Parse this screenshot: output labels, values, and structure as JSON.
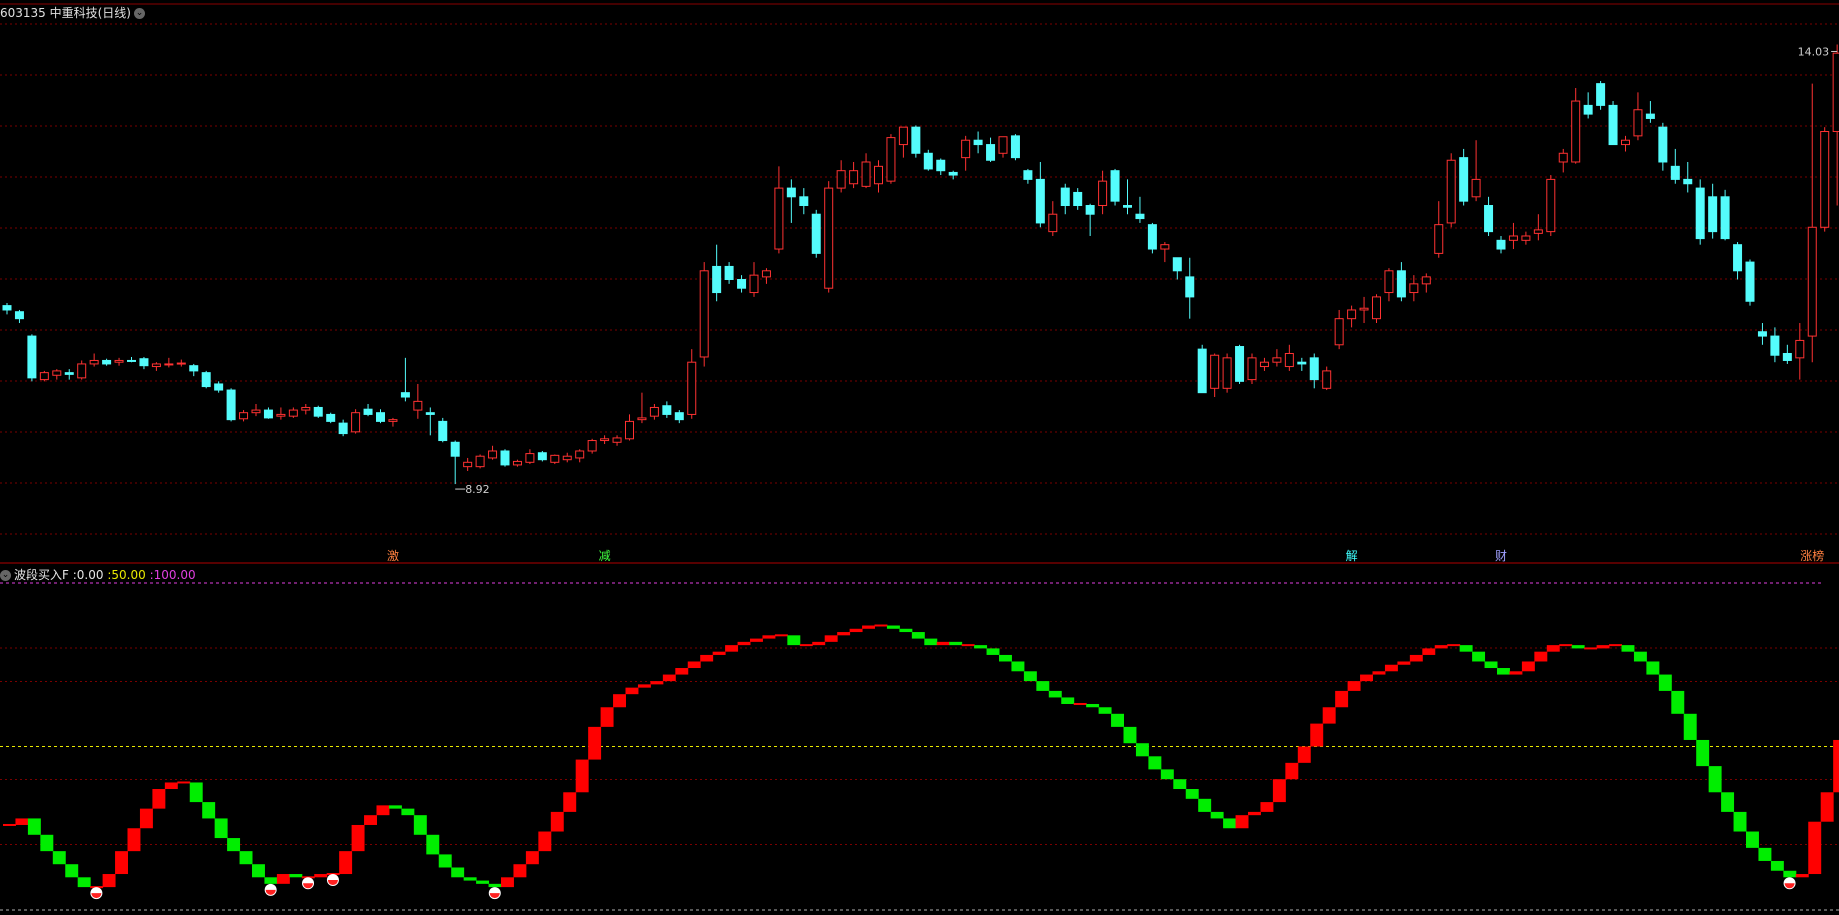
{
  "header": {
    "title": "603135 中重科技(日线)",
    "indicator_name": "波段买入F",
    "values": [
      ":0.00",
      ":50.00",
      ":100.00"
    ]
  },
  "colors": {
    "up": "#ff3232",
    "down": "#54fcfc",
    "buy_bar": "#ff0000",
    "sell_bar": "#00ee00",
    "grid": "#7a0000",
    "yellow": "#e8e800",
    "magenta": "#e040e0"
  },
  "chart_data": [
    {
      "type": "candlestick",
      "ylim": [
        8.3,
        14.4
      ],
      "annotations": {
        "high": "14.03",
        "low": "8.92"
      },
      "event_labels": [
        {
          "text": "激",
          "index": 31,
          "color": "#ff8040"
        },
        {
          "text": "减",
          "index": 48,
          "color": "#40ff40"
        },
        {
          "text": "解",
          "index": 108,
          "color": "#40ffff"
        },
        {
          "text": "财",
          "index": 120,
          "color": "#a0a0ff"
        },
        {
          "text": "涨榜",
          "index": 145,
          "color": "#ff8040"
        }
      ],
      "candles": [
        {
          "o": 11.05,
          "h": 11.08,
          "l": 10.95,
          "c": 11.0
        },
        {
          "o": 10.98,
          "h": 11.0,
          "l": 10.85,
          "c": 10.9
        },
        {
          "o": 10.7,
          "h": 10.72,
          "l": 10.18,
          "c": 10.22
        },
        {
          "o": 10.2,
          "h": 10.3,
          "l": 10.18,
          "c": 10.28
        },
        {
          "o": 10.25,
          "h": 10.32,
          "l": 10.2,
          "c": 10.3
        },
        {
          "o": 10.28,
          "h": 10.32,
          "l": 10.2,
          "c": 10.26
        },
        {
          "o": 10.22,
          "h": 10.42,
          "l": 10.2,
          "c": 10.38
        },
        {
          "o": 10.38,
          "h": 10.5,
          "l": 10.35,
          "c": 10.42
        },
        {
          "o": 10.42,
          "h": 10.44,
          "l": 10.36,
          "c": 10.38
        },
        {
          "o": 10.4,
          "h": 10.45,
          "l": 10.36,
          "c": 10.42
        },
        {
          "o": 10.42,
          "h": 10.46,
          "l": 10.4,
          "c": 10.41
        },
        {
          "o": 10.44,
          "h": 10.46,
          "l": 10.32,
          "c": 10.36
        },
        {
          "o": 10.35,
          "h": 10.4,
          "l": 10.3,
          "c": 10.38
        },
        {
          "o": 10.38,
          "h": 10.45,
          "l": 10.34,
          "c": 10.38
        },
        {
          "o": 10.39,
          "h": 10.43,
          "l": 10.35,
          "c": 10.39
        },
        {
          "o": 10.36,
          "h": 10.38,
          "l": 10.24,
          "c": 10.3
        },
        {
          "o": 10.28,
          "h": 10.3,
          "l": 10.1,
          "c": 10.12
        },
        {
          "o": 10.15,
          "h": 10.18,
          "l": 10.05,
          "c": 10.08
        },
        {
          "o": 10.08,
          "h": 10.1,
          "l": 9.72,
          "c": 9.74
        },
        {
          "o": 9.75,
          "h": 9.85,
          "l": 9.72,
          "c": 9.82
        },
        {
          "o": 9.82,
          "h": 9.92,
          "l": 9.78,
          "c": 9.85
        },
        {
          "o": 9.85,
          "h": 9.88,
          "l": 9.75,
          "c": 9.76
        },
        {
          "o": 9.78,
          "h": 9.88,
          "l": 9.74,
          "c": 9.8
        },
        {
          "o": 9.78,
          "h": 9.88,
          "l": 9.76,
          "c": 9.85
        },
        {
          "o": 9.85,
          "h": 9.92,
          "l": 9.8,
          "c": 9.88
        },
        {
          "o": 9.88,
          "h": 9.9,
          "l": 9.76,
          "c": 9.78
        },
        {
          "o": 9.8,
          "h": 9.82,
          "l": 9.7,
          "c": 9.72
        },
        {
          "o": 9.7,
          "h": 9.74,
          "l": 9.55,
          "c": 9.58
        },
        {
          "o": 9.6,
          "h": 9.86,
          "l": 9.58,
          "c": 9.82
        },
        {
          "o": 9.86,
          "h": 9.92,
          "l": 9.78,
          "c": 9.8
        },
        {
          "o": 9.82,
          "h": 9.86,
          "l": 9.7,
          "c": 9.72
        },
        {
          "o": 9.72,
          "h": 9.76,
          "l": 9.66,
          "c": 9.74
        },
        {
          "o": 10.05,
          "h": 10.45,
          "l": 9.95,
          "c": 10.0
        },
        {
          "o": 9.85,
          "h": 10.15,
          "l": 9.75,
          "c": 9.95
        },
        {
          "o": 9.82,
          "h": 9.88,
          "l": 9.56,
          "c": 9.8
        },
        {
          "o": 9.72,
          "h": 9.76,
          "l": 9.48,
          "c": 9.5
        },
        {
          "o": 9.48,
          "h": 9.5,
          "l": 9.0,
          "c": 9.32
        },
        {
          "o": 9.2,
          "h": 9.3,
          "l": 9.15,
          "c": 9.25
        },
        {
          "o": 9.2,
          "h": 9.34,
          "l": 9.18,
          "c": 9.32
        },
        {
          "o": 9.3,
          "h": 9.44,
          "l": 9.28,
          "c": 9.38
        },
        {
          "o": 9.38,
          "h": 9.4,
          "l": 9.2,
          "c": 9.22
        },
        {
          "o": 9.22,
          "h": 9.28,
          "l": 9.2,
          "c": 9.26
        },
        {
          "o": 9.25,
          "h": 9.4,
          "l": 9.23,
          "c": 9.35
        },
        {
          "o": 9.36,
          "h": 9.38,
          "l": 9.26,
          "c": 9.28
        },
        {
          "o": 9.25,
          "h": 9.34,
          "l": 9.23,
          "c": 9.33
        },
        {
          "o": 9.28,
          "h": 9.36,
          "l": 9.25,
          "c": 9.32
        },
        {
          "o": 9.3,
          "h": 9.4,
          "l": 9.25,
          "c": 9.38
        },
        {
          "o": 9.38,
          "h": 9.52,
          "l": 9.35,
          "c": 9.5
        },
        {
          "o": 9.5,
          "h": 9.56,
          "l": 9.46,
          "c": 9.52
        },
        {
          "o": 9.48,
          "h": 9.56,
          "l": 9.44,
          "c": 9.53
        },
        {
          "o": 9.52,
          "h": 9.8,
          "l": 9.5,
          "c": 9.72
        },
        {
          "o": 9.74,
          "h": 10.05,
          "l": 9.7,
          "c": 9.76
        },
        {
          "o": 9.78,
          "h": 9.92,
          "l": 9.74,
          "c": 9.88
        },
        {
          "o": 9.9,
          "h": 9.95,
          "l": 9.76,
          "c": 9.8
        },
        {
          "o": 9.82,
          "h": 9.85,
          "l": 9.7,
          "c": 9.74
        },
        {
          "o": 9.8,
          "h": 10.55,
          "l": 9.75,
          "c": 10.4
        },
        {
          "o": 10.46,
          "h": 11.55,
          "l": 10.35,
          "c": 11.45
        },
        {
          "o": 11.5,
          "h": 11.75,
          "l": 11.1,
          "c": 11.2
        },
        {
          "o": 11.5,
          "h": 11.55,
          "l": 11.3,
          "c": 11.35
        },
        {
          "o": 11.35,
          "h": 11.4,
          "l": 11.2,
          "c": 11.25
        },
        {
          "o": 11.2,
          "h": 11.55,
          "l": 11.15,
          "c": 11.4
        },
        {
          "o": 11.38,
          "h": 11.48,
          "l": 11.3,
          "c": 11.45
        },
        {
          "o": 11.7,
          "h": 12.65,
          "l": 11.65,
          "c": 12.4
        },
        {
          "o": 12.4,
          "h": 12.5,
          "l": 12.0,
          "c": 12.3
        },
        {
          "o": 12.3,
          "h": 12.4,
          "l": 12.1,
          "c": 12.2
        },
        {
          "o": 12.1,
          "h": 12.15,
          "l": 11.6,
          "c": 11.65
        },
        {
          "o": 11.25,
          "h": 12.48,
          "l": 11.2,
          "c": 12.4
        },
        {
          "o": 12.4,
          "h": 12.72,
          "l": 12.35,
          "c": 12.6
        },
        {
          "o": 12.45,
          "h": 12.7,
          "l": 12.4,
          "c": 12.6
        },
        {
          "o": 12.42,
          "h": 12.8,
          "l": 12.4,
          "c": 12.7
        },
        {
          "o": 12.45,
          "h": 12.72,
          "l": 12.35,
          "c": 12.65
        },
        {
          "o": 12.48,
          "h": 13.02,
          "l": 12.45,
          "c": 12.98
        },
        {
          "o": 12.9,
          "h": 13.05,
          "l": 12.75,
          "c": 13.1
        },
        {
          "o": 13.1,
          "h": 13.12,
          "l": 12.75,
          "c": 12.8
        },
        {
          "o": 12.8,
          "h": 12.84,
          "l": 12.6,
          "c": 12.62
        },
        {
          "o": 12.72,
          "h": 12.74,
          "l": 12.55,
          "c": 12.6
        },
        {
          "o": 12.58,
          "h": 12.6,
          "l": 12.5,
          "c": 12.55
        },
        {
          "o": 12.75,
          "h": 13.0,
          "l": 12.6,
          "c": 12.95
        },
        {
          "o": 12.95,
          "h": 13.05,
          "l": 12.8,
          "c": 12.9
        },
        {
          "o": 12.9,
          "h": 12.98,
          "l": 12.7,
          "c": 12.72
        },
        {
          "o": 12.8,
          "h": 12.9,
          "l": 12.75,
          "c": 12.99
        },
        {
          "o": 13.0,
          "h": 13.02,
          "l": 12.72,
          "c": 12.75
        },
        {
          "o": 12.6,
          "h": 12.62,
          "l": 12.45,
          "c": 12.5
        },
        {
          "o": 12.5,
          "h": 12.7,
          "l": 11.95,
          "c": 12.0
        },
        {
          "o": 11.9,
          "h": 12.25,
          "l": 11.85,
          "c": 12.1
        },
        {
          "o": 12.4,
          "h": 12.45,
          "l": 12.1,
          "c": 12.2
        },
        {
          "o": 12.35,
          "h": 12.4,
          "l": 12.15,
          "c": 12.2
        },
        {
          "o": 12.2,
          "h": 12.22,
          "l": 11.85,
          "c": 12.1
        },
        {
          "o": 12.2,
          "h": 12.6,
          "l": 12.1,
          "c": 12.48
        },
        {
          "o": 12.6,
          "h": 12.62,
          "l": 12.2,
          "c": 12.25
        },
        {
          "o": 12.2,
          "h": 12.5,
          "l": 12.1,
          "c": 12.18
        },
        {
          "o": 12.1,
          "h": 12.3,
          "l": 12.0,
          "c": 12.05
        },
        {
          "o": 11.98,
          "h": 12.0,
          "l": 11.65,
          "c": 11.7
        },
        {
          "o": 11.7,
          "h": 11.78,
          "l": 11.55,
          "c": 11.75
        },
        {
          "o": 11.6,
          "h": 11.6,
          "l": 11.35,
          "c": 11.45
        },
        {
          "o": 11.38,
          "h": 11.6,
          "l": 10.9,
          "c": 11.15
        },
        {
          "o": 10.55,
          "h": 10.6,
          "l": 10.05,
          "c": 10.05
        },
        {
          "o": 10.1,
          "h": 10.5,
          "l": 10.0,
          "c": 10.48
        },
        {
          "o": 10.1,
          "h": 10.5,
          "l": 10.05,
          "c": 10.45
        },
        {
          "o": 10.58,
          "h": 10.6,
          "l": 10.15,
          "c": 10.18
        },
        {
          "o": 10.2,
          "h": 10.5,
          "l": 10.15,
          "c": 10.45
        },
        {
          "o": 10.35,
          "h": 10.45,
          "l": 10.3,
          "c": 10.4
        },
        {
          "o": 10.4,
          "h": 10.55,
          "l": 10.35,
          "c": 10.45
        },
        {
          "o": 10.35,
          "h": 10.6,
          "l": 10.3,
          "c": 10.5
        },
        {
          "o": 10.4,
          "h": 10.45,
          "l": 10.3,
          "c": 10.38
        },
        {
          "o": 10.45,
          "h": 10.5,
          "l": 10.1,
          "c": 10.2
        },
        {
          "o": 10.1,
          "h": 10.35,
          "l": 10.08,
          "c": 10.3
        },
        {
          "o": 10.6,
          "h": 11.0,
          "l": 10.55,
          "c": 10.9
        },
        {
          "o": 10.9,
          "h": 11.05,
          "l": 10.8,
          "c": 11.0
        },
        {
          "o": 11.0,
          "h": 11.15,
          "l": 10.85,
          "c": 11.02
        },
        {
          "o": 10.9,
          "h": 11.18,
          "l": 10.85,
          "c": 11.15
        },
        {
          "o": 11.2,
          "h": 11.48,
          "l": 11.1,
          "c": 11.45
        },
        {
          "o": 11.45,
          "h": 11.55,
          "l": 11.1,
          "c": 11.15
        },
        {
          "o": 11.2,
          "h": 11.4,
          "l": 11.1,
          "c": 11.3
        },
        {
          "o": 11.3,
          "h": 11.42,
          "l": 11.2,
          "c": 11.38
        },
        {
          "o": 11.65,
          "h": 12.25,
          "l": 11.6,
          "c": 11.98
        },
        {
          "o": 12.0,
          "h": 12.8,
          "l": 11.95,
          "c": 12.72
        },
        {
          "o": 12.75,
          "h": 12.85,
          "l": 12.2,
          "c": 12.25
        },
        {
          "o": 12.3,
          "h": 12.95,
          "l": 12.25,
          "c": 12.5
        },
        {
          "o": 12.2,
          "h": 12.3,
          "l": 11.85,
          "c": 11.9
        },
        {
          "o": 11.8,
          "h": 11.85,
          "l": 11.65,
          "c": 11.7
        },
        {
          "o": 11.8,
          "h": 12.0,
          "l": 11.7,
          "c": 11.85
        },
        {
          "o": 11.8,
          "h": 11.9,
          "l": 11.75,
          "c": 11.85
        },
        {
          "o": 11.88,
          "h": 12.1,
          "l": 11.8,
          "c": 11.92
        },
        {
          "o": 11.9,
          "h": 12.55,
          "l": 11.85,
          "c": 12.5
        },
        {
          "o": 12.7,
          "h": 12.85,
          "l": 12.58,
          "c": 12.8
        },
        {
          "o": 12.7,
          "h": 13.55,
          "l": 12.68,
          "c": 13.4
        },
        {
          "o": 13.35,
          "h": 13.5,
          "l": 13.2,
          "c": 13.25
        },
        {
          "o": 13.6,
          "h": 13.63,
          "l": 13.3,
          "c": 13.35
        },
        {
          "o": 13.35,
          "h": 13.4,
          "l": 12.9,
          "c": 12.9
        },
        {
          "o": 12.9,
          "h": 13.0,
          "l": 12.82,
          "c": 12.95
        },
        {
          "o": 13.0,
          "h": 13.5,
          "l": 12.95,
          "c": 13.3
        },
        {
          "o": 13.25,
          "h": 13.4,
          "l": 13.15,
          "c": 13.2
        },
        {
          "o": 13.1,
          "h": 13.15,
          "l": 12.6,
          "c": 12.7
        },
        {
          "o": 12.65,
          "h": 12.85,
          "l": 12.45,
          "c": 12.5
        },
        {
          "o": 12.5,
          "h": 12.7,
          "l": 12.35,
          "c": 12.45
        },
        {
          "o": 12.4,
          "h": 12.5,
          "l": 11.75,
          "c": 11.82
        },
        {
          "o": 12.3,
          "h": 12.45,
          "l": 11.82,
          "c": 11.9
        },
        {
          "o": 12.3,
          "h": 12.38,
          "l": 11.8,
          "c": 11.82
        },
        {
          "o": 11.75,
          "h": 11.78,
          "l": 11.35,
          "c": 11.45
        },
        {
          "o": 11.55,
          "h": 11.58,
          "l": 11.05,
          "c": 11.1
        },
        {
          "o": 10.75,
          "h": 10.85,
          "l": 10.6,
          "c": 10.7
        },
        {
          "o": 10.7,
          "h": 10.8,
          "l": 10.4,
          "c": 10.48
        },
        {
          "o": 10.5,
          "h": 10.6,
          "l": 10.38,
          "c": 10.42
        },
        {
          "o": 10.45,
          "h": 10.85,
          "l": 10.2,
          "c": 10.65
        },
        {
          "o": 10.7,
          "h": 13.6,
          "l": 10.4,
          "c": 11.95
        },
        {
          "o": 11.95,
          "h": 13.1,
          "l": 11.9,
          "c": 13.05
        },
        {
          "o": 13.05,
          "h": 14.05,
          "l": 12.2,
          "c": 13.95
        }
      ]
    },
    {
      "type": "step",
      "title": "波段买入F",
      "levels": [
        0,
        50,
        100
      ],
      "ylim": [
        0,
        100
      ],
      "values": [
        26,
        28,
        23,
        18,
        14,
        10,
        7,
        7,
        11,
        18,
        25,
        31,
        37,
        39,
        39,
        33,
        28,
        22,
        18,
        14,
        10,
        8,
        11,
        10,
        10,
        11,
        11,
        18,
        26,
        29,
        32,
        31,
        29,
        23,
        17,
        13,
        10,
        9,
        8,
        7,
        10,
        14,
        18,
        24,
        30,
        36,
        46,
        56,
        62,
        66,
        68,
        69,
        70,
        72,
        74,
        76,
        78,
        79,
        81,
        82,
        83,
        84,
        84,
        81,
        81,
        82,
        84,
        85,
        86,
        87,
        87,
        86,
        85,
        83,
        81,
        82,
        81,
        81,
        80,
        78,
        76,
        73,
        70,
        67,
        65,
        63,
        63,
        62,
        60,
        56,
        51,
        47,
        43,
        40,
        37,
        34,
        30,
        28,
        25,
        29,
        30,
        33,
        40,
        45,
        50,
        57,
        62,
        67,
        70,
        72,
        73,
        75,
        76,
        78,
        80,
        81,
        81,
        79,
        76,
        74,
        72,
        73,
        76,
        79,
        81,
        81,
        80,
        80,
        81,
        81,
        79,
        76,
        72,
        67,
        60,
        52,
        44,
        36,
        30,
        24,
        19,
        15,
        12,
        10,
        11,
        27,
        36,
        52
      ]
    }
  ]
}
